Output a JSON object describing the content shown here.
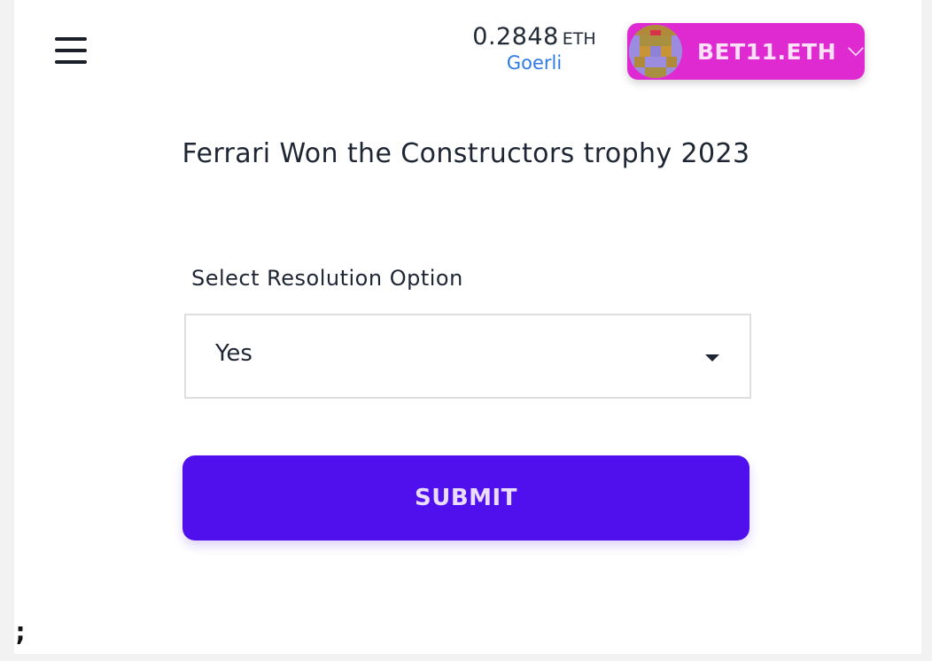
{
  "header": {
    "balance_amount": "0.2848",
    "balance_unit": "ETH",
    "network": "Goerli",
    "account_name": "BET11.ETH",
    "account_color": "#e02ad1"
  },
  "question": {
    "title": "Ferrari Won the Constructors trophy 2023"
  },
  "resolution": {
    "label": "Select Resolution Option",
    "selected": "Yes"
  },
  "submit": {
    "label": "SUBMIT",
    "color": "#5010ed"
  },
  "footer": {
    "stray_text": ";"
  },
  "icons": [
    "menu-icon",
    "avatar-icon",
    "chevron-down-icon",
    "caret-down-icon"
  ]
}
